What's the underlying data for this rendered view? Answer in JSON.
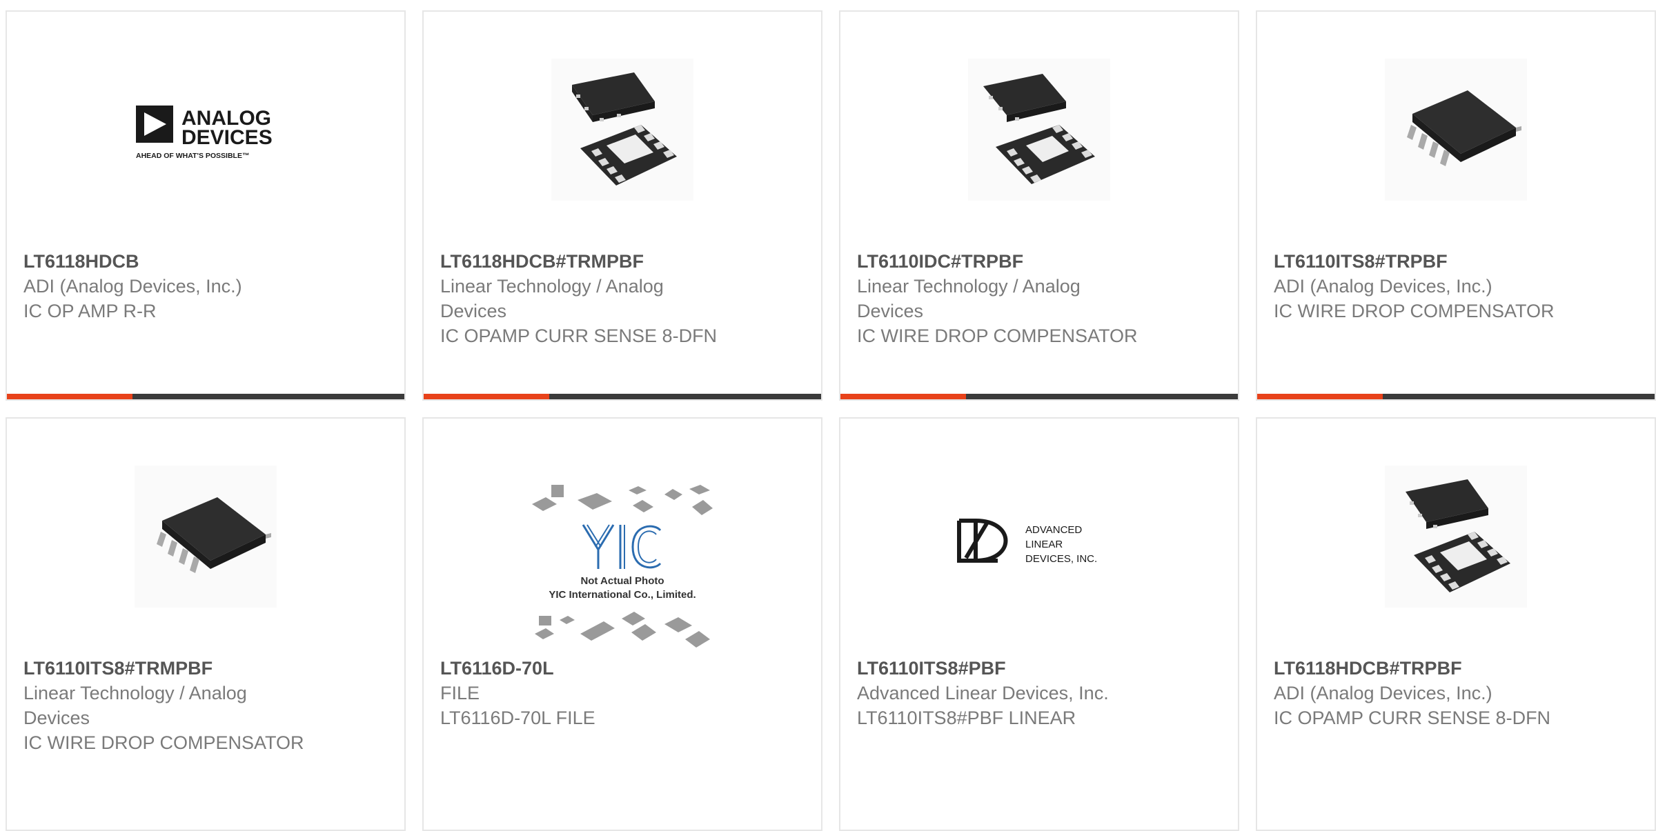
{
  "colors": {
    "accent": "#e8421a",
    "bar": "#3b3b3b",
    "border": "#e6e6e6",
    "part_text": "#555555",
    "body_text": "#7a7a7a"
  },
  "products": [
    {
      "part": "LT6118HDCB",
      "manufacturer": "ADI (Analog Devices, Inc.)",
      "description": "IC OP AMP R-R",
      "image": "analog-devices-logo",
      "logo_main": [
        "ANALOG",
        "DEVICES"
      ],
      "logo_tag": "AHEAD OF WHAT'S POSSIBLE™"
    },
    {
      "part": "LT6118HDCB#TRMPBF",
      "manufacturer": "Linear Technology / Analog Devices",
      "description": "IC OPAMP CURR SENSE 8-DFN",
      "image": "dfn-chip"
    },
    {
      "part": "LT6110IDC#TRPBF",
      "manufacturer": "Linear Technology / Analog Devices",
      "description": "IC WIRE DROP COMPENSATOR",
      "image": "dfn-chip"
    },
    {
      "part": "LT6110ITS8#TRPBF",
      "manufacturer": "ADI (Analog Devices, Inc.)",
      "description": "IC WIRE DROP COMPENSATOR",
      "image": "sot-chip"
    },
    {
      "part": "LT6110ITS8#TRMPBF",
      "manufacturer": "Linear Technology / Analog Devices",
      "description": "IC WIRE DROP COMPENSATOR",
      "image": "sot-chip"
    },
    {
      "part": "LT6116D-70L",
      "manufacturer": "FILE",
      "description": "LT6116D-70L FILE",
      "image": "yic-placeholder",
      "placeholder_logo": "YIC",
      "placeholder_lines": [
        "Not Actual Photo",
        "YIC International Co., Limited."
      ]
    },
    {
      "part": "LT6110ITS8#PBF",
      "manufacturer": "Advanced Linear Devices, Inc.",
      "description": "LT6110ITS8#PBF LINEAR",
      "image": "ald-logo",
      "logo_lines": [
        "ADVANCED",
        "LINEAR",
        "DEVICES, INC."
      ]
    },
    {
      "part": "LT6118HDCB#TRPBF",
      "manufacturer": "ADI (Analog Devices, Inc.)",
      "description": "IC OPAMP CURR SENSE 8-DFN",
      "image": "dfn-chip"
    }
  ]
}
